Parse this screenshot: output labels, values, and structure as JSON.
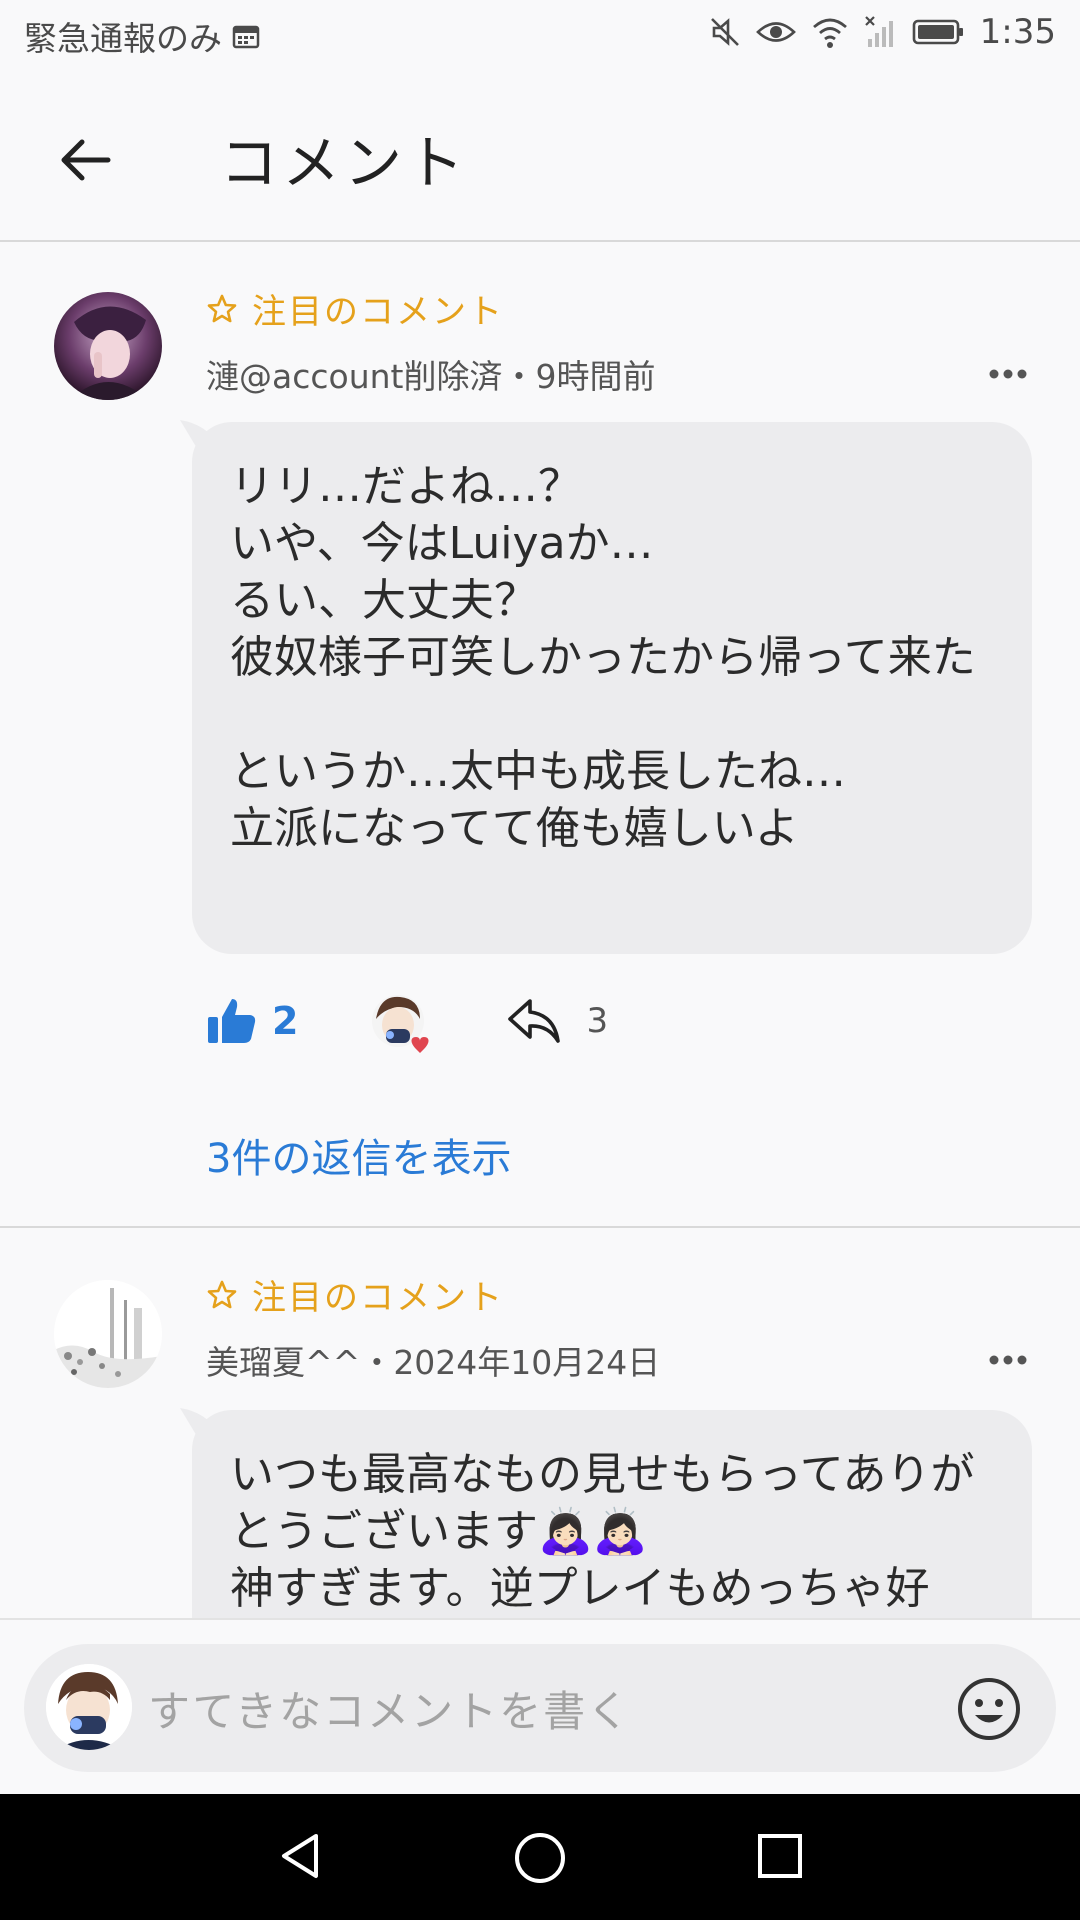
{
  "status_bar": {
    "carrier_text": "緊急通報のみ",
    "time": "1:35",
    "icons": [
      "calendar-icon",
      "mute-icon",
      "eye-icon",
      "wifi-icon",
      "signal-icon",
      "battery-icon"
    ]
  },
  "app_bar": {
    "title": "コメント",
    "back_icon": "back-arrow-icon"
  },
  "comments": [
    {
      "featured_label": "注目のコメント",
      "author": "漣@account削除済",
      "separator": "・",
      "time": "9時間前",
      "text": "リリ…だよね…？\nいや、今はLuiyaか…\nるい、大丈夫？\n彼奴様子可笑しかったから帰って来た\n\nというか…太中も成長したね…\n立派になってて俺も嬉しいよ",
      "like_count": "2",
      "reply_count": "3",
      "view_replies": "3件の返信を表示"
    },
    {
      "featured_label": "注目のコメント",
      "author": "美瑠夏^^",
      "separator": "・",
      "time": "2024年10月24日",
      "text": "いつも最高なもの見せもらってありがとうございます🙇🏻‍♀️🙇🏻‍♀️\n神すぎます。逆プレイもめっちゃ好"
    }
  ],
  "composer": {
    "placeholder": "すてきなコメントを書く",
    "emoji_icon": "smiley-icon"
  },
  "colors": {
    "accent_blue": "#2a7bd6",
    "featured_gold": "#e5a11b",
    "bubble_bg": "#ececee"
  }
}
